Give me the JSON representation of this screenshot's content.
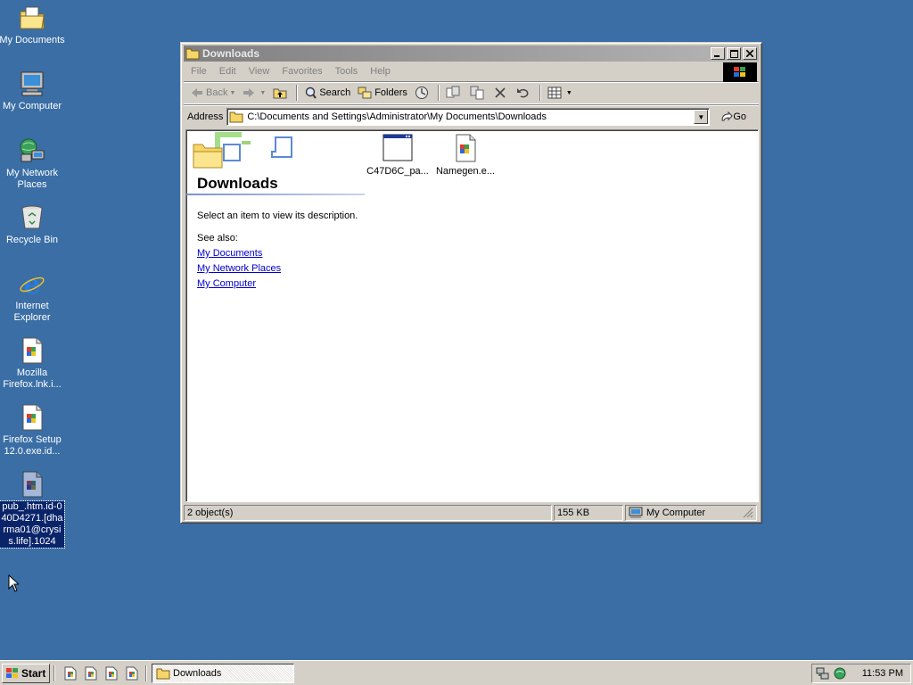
{
  "desktop": {
    "icons": [
      {
        "label": "My Documents"
      },
      {
        "label": "My Computer"
      },
      {
        "label": "My Network Places"
      },
      {
        "label": "Recycle Bin"
      },
      {
        "label": "Internet Explorer"
      },
      {
        "label": "Mozilla Firefox.lnk.i..."
      },
      {
        "label": "Firefox Setup 12.0.exe.id..."
      },
      {
        "label": "pub_.htm.id-040D4271.[dharma01@crysis.life].1024"
      }
    ]
  },
  "window": {
    "title": "Downloads",
    "menu": [
      "File",
      "Edit",
      "View",
      "Favorites",
      "Tools",
      "Help"
    ],
    "toolbar": {
      "back": "Back",
      "search": "Search",
      "folders": "Folders"
    },
    "address": {
      "label": "Address",
      "value": "C:\\Documents and Settings\\Administrator\\My Documents\\Downloads",
      "go": "Go"
    },
    "panel": {
      "title": "Downloads",
      "description": "Select an item to view its description.",
      "see_also": "See also:",
      "links": [
        "My Documents",
        "My Network Places",
        "My Computer"
      ]
    },
    "files": [
      {
        "name": "C47D6C_pa..."
      },
      {
        "name": "Namegen.e..."
      }
    ],
    "status": {
      "objects": "2 object(s)",
      "size": "155 KB",
      "zone": "My Computer"
    }
  },
  "taskbar": {
    "start": "Start",
    "task": "Downloads",
    "clock": "11:53 PM"
  }
}
